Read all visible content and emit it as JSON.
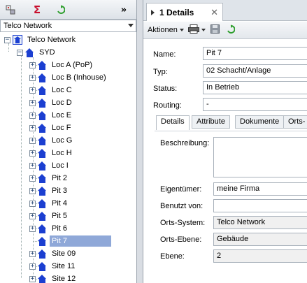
{
  "left": {
    "combo_value": "Telco Network",
    "root_label": "Telco Network",
    "syd_label": "SYD",
    "items": [
      "Loc A (PoP)",
      "Loc B (Inhouse)",
      "Loc C",
      "Loc D",
      "Loc E",
      "Loc F",
      "Loc G",
      "Loc H",
      "Loc I",
      "Pit 2",
      "Pit 3",
      "Pit 4",
      "Pit 5",
      "Pit 6",
      "Pit 7",
      "Site 09",
      "Site 11",
      "Site 12"
    ],
    "selected_item": "Pit 7"
  },
  "right": {
    "doc_tab": "1 Details",
    "actions_label": "Aktionen",
    "fields": {
      "name_label": "Name:",
      "name_value": "Pit 7",
      "typ_label": "Typ:",
      "typ_value": "02 Schacht/Anlage",
      "status_label": "Status:",
      "status_value": "In Betrieb",
      "routing_label": "Routing:",
      "routing_value": "-"
    },
    "subtabs": [
      "Details",
      "Attribute",
      "Dokumente",
      "Orts-"
    ],
    "details": {
      "beschreibung_label": "Beschreibung:",
      "beschreibung_value": "",
      "eigentuemer_label": "Eigentümer:",
      "eigentuemer_value": "meine Firma",
      "benutzt_label": "Benutzt von:",
      "benutzt_value": "",
      "ortssystem_label": "Orts-System:",
      "ortssystem_value": "Telco Network",
      "ortsebene_label": "Orts-Ebene:",
      "ortsebene_value": "Gebäude",
      "ebene_label": "Ebene:",
      "ebene_value": "2"
    }
  },
  "colors": {
    "house": "#1b3fd1",
    "selection": "#8fa8d8",
    "sigma": "#c8102e",
    "refresh": "#2e9e2e"
  }
}
